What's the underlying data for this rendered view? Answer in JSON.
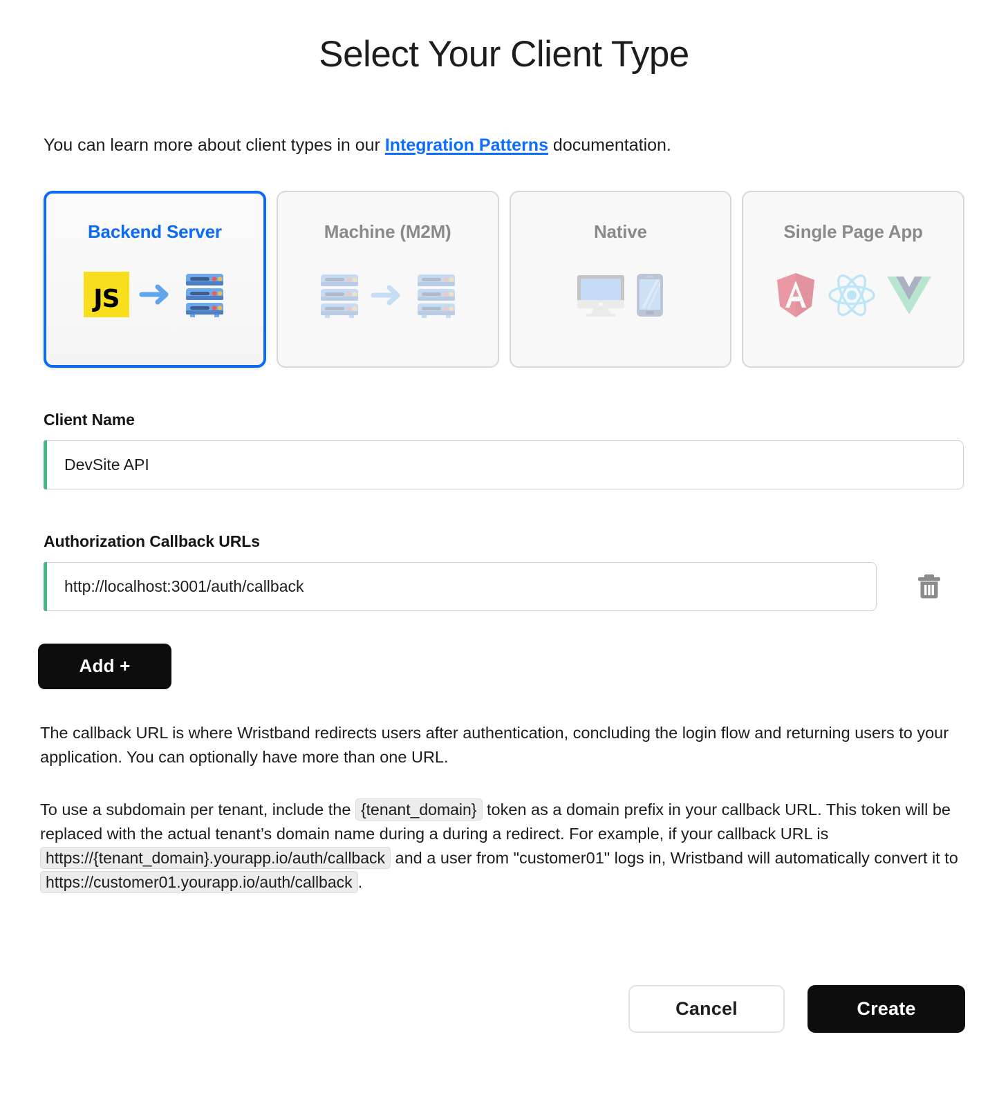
{
  "title": "Select Your Client Type",
  "intro": {
    "before": "You can learn more about client types in our ",
    "link": "Integration Patterns",
    "after": " documentation."
  },
  "client_types": [
    {
      "label": "Backend Server",
      "selected": true,
      "icons": [
        "js-logo-icon",
        "arrow-right-icon",
        "server-rack-icon"
      ]
    },
    {
      "label": "Machine (M2M)",
      "selected": false,
      "icons": [
        "server-rack-icon",
        "arrow-right-icon",
        "server-rack-icon"
      ]
    },
    {
      "label": "Native",
      "selected": false,
      "icons": [
        "desktop-monitor-icon",
        "mobile-phone-icon"
      ]
    },
    {
      "label": "Single Page App",
      "selected": false,
      "icons": [
        "angular-logo-icon",
        "react-logo-icon",
        "vue-logo-icon"
      ]
    }
  ],
  "client_name": {
    "label": "Client Name",
    "value": "DevSite API",
    "placeholder": "Client Name"
  },
  "callback_urls": {
    "label": "Authorization Callback URLs",
    "value": "http://localhost:3001/auth/callback",
    "placeholder": "http://localhost:3001/auth/callback",
    "delete_icon": "trash-icon"
  },
  "add_button": "Add +",
  "help": {
    "paragraph1": "The callback URL is where Wristband redirects users after authentication, concluding the login flow and returning users to your application. You can optionally have more than one URL.",
    "p2_part1": "To use a subdomain per tenant, include the ",
    "p2_token1": "{tenant_domain}",
    "p2_part2": " token as a domain prefix in your callback URL. This token will be replaced with the actual tenant’s domain name during a during a redirect. For example, if your callback URL is ",
    "p2_token2": "https://{tenant_domain}.yourapp.io/auth/callback",
    "p2_part3": " and a user from \"customer01\" logs in, Wristband will automatically convert it to ",
    "p2_token3": "https://customer01.yourapp.io/auth/callback",
    "p2_part4": "."
  },
  "footer": {
    "cancel": "Cancel",
    "create": "Create"
  },
  "colors": {
    "selected_border": "#0b6bf2",
    "selected_label": "#0b6bf2",
    "link": "#0d6efd",
    "input_accent": "#46b883",
    "primary_button": "#0d0d0d",
    "card_label": "#8a8a8a",
    "js_yellow": "#f7df1e",
    "angular_red": "#dd4a60",
    "react_blue": "#8ed6f9",
    "vue_green": "#82d6ae"
  }
}
